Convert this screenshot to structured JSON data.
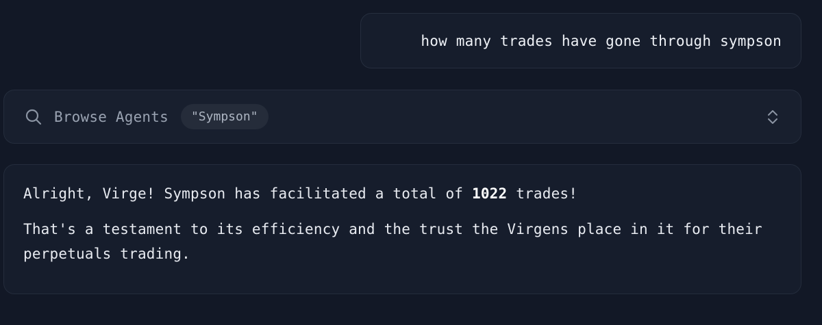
{
  "user_message": {
    "text": "how many trades have gone through sympson"
  },
  "tool_call": {
    "icon": "search-icon",
    "label": "Browse Agents",
    "query": "\"Sympson\"",
    "expand_icon": "chevron-up-down-icon"
  },
  "assistant_reply": {
    "p1_before": "Alright, Virge! Sympson has facilitated a total of ",
    "p1_bold": "1022",
    "p1_after": " trades!",
    "p2": "That's a testament to its efficiency and the trust the Virgens place in it for their perpetuals trading."
  },
  "colors": {
    "background": "#121826",
    "card": "#161d2c",
    "border": "#262e3e",
    "muted_text": "#9aa3b2",
    "text": "#e8ebf1"
  }
}
